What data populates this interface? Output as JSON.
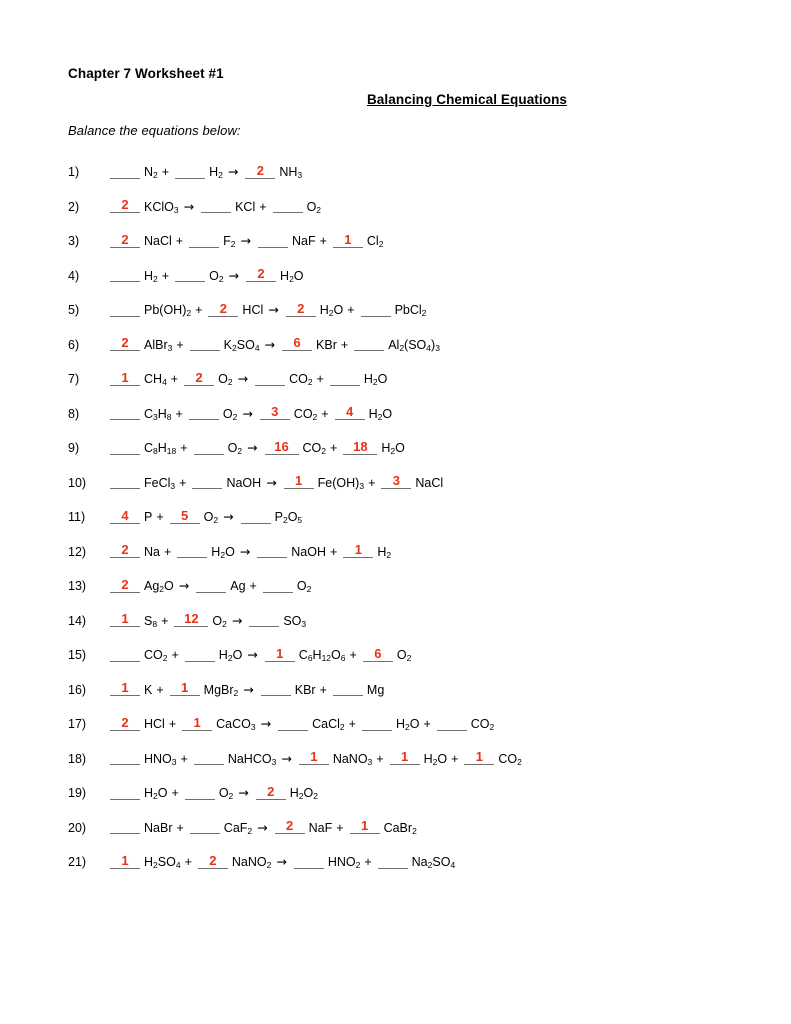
{
  "document": {
    "title": "Chapter 7 Worksheet #1",
    "worksheet_title": "Balancing Chemical Equations",
    "instruction": "Balance the equations below:",
    "answer_color": "#e8331a",
    "arrow": "→",
    "plus": "+"
  },
  "equations": [
    {
      "number": "1)",
      "parts": [
        {
          "type": "slot",
          "answer": ""
        },
        {
          "type": "term",
          "formula": "N",
          "sub": "2"
        },
        {
          "type": "op",
          "text": "+"
        },
        {
          "type": "slot",
          "answer": ""
        },
        {
          "type": "term",
          "formula": "H",
          "sub": "2"
        },
        {
          "type": "arrow"
        },
        {
          "type": "slot",
          "answer": "2"
        },
        {
          "type": "term",
          "formula": "NH",
          "sub": "3"
        }
      ]
    },
    {
      "number": "2)",
      "parts": [
        {
          "type": "slot",
          "answer": "2"
        },
        {
          "type": "term",
          "formula": "KClO",
          "sub": "3"
        },
        {
          "type": "arrow"
        },
        {
          "type": "slot",
          "answer": ""
        },
        {
          "type": "term",
          "formula": "KCl",
          "sub": ""
        },
        {
          "type": "op",
          "text": "+"
        },
        {
          "type": "slot",
          "answer": ""
        },
        {
          "type": "term",
          "formula": "O",
          "sub": "2"
        }
      ]
    },
    {
      "number": "3)",
      "parts": [
        {
          "type": "slot",
          "answer": "2"
        },
        {
          "type": "term",
          "formula": "NaCl",
          "sub": ""
        },
        {
          "type": "op",
          "text": "+"
        },
        {
          "type": "slot",
          "answer": ""
        },
        {
          "type": "term",
          "formula": "F",
          "sub": "2"
        },
        {
          "type": "arrow"
        },
        {
          "type": "slot",
          "answer": ""
        },
        {
          "type": "term",
          "formula": "NaF",
          "sub": ""
        },
        {
          "type": "op",
          "text": "+"
        },
        {
          "type": "slot",
          "answer": "1"
        },
        {
          "type": "term",
          "formula": "Cl",
          "sub": "2"
        }
      ]
    },
    {
      "number": "4)",
      "parts": [
        {
          "type": "slot",
          "answer": ""
        },
        {
          "type": "term",
          "formula": "H",
          "sub": "2"
        },
        {
          "type": "op",
          "text": "+"
        },
        {
          "type": "slot",
          "answer": ""
        },
        {
          "type": "term",
          "formula": "O",
          "sub": "2"
        },
        {
          "type": "arrow"
        },
        {
          "type": "slot",
          "answer": "2"
        },
        {
          "type": "term",
          "formula": "H",
          "sub": "2",
          "tail": "O"
        }
      ]
    },
    {
      "number": "5)",
      "parts": [
        {
          "type": "slot",
          "answer": ""
        },
        {
          "type": "term",
          "formula": "Pb(OH)",
          "sub": "2"
        },
        {
          "type": "op",
          "text": "+"
        },
        {
          "type": "slot",
          "answer": "2"
        },
        {
          "type": "term",
          "formula": "HCl",
          "sub": ""
        },
        {
          "type": "arrow"
        },
        {
          "type": "slot",
          "answer": "2"
        },
        {
          "type": "term",
          "formula": "H",
          "sub": "2",
          "tail": "O"
        },
        {
          "type": "op",
          "text": "+"
        },
        {
          "type": "slot",
          "answer": ""
        },
        {
          "type": "term",
          "formula": "PbCl",
          "sub": "2"
        }
      ]
    },
    {
      "number": "6)",
      "parts": [
        {
          "type": "slot",
          "answer": "2"
        },
        {
          "type": "term",
          "formula": "AlBr",
          "sub": "3"
        },
        {
          "type": "op",
          "text": "+"
        },
        {
          "type": "slot",
          "answer": ""
        },
        {
          "type": "term",
          "formula": "K",
          "sub": "2",
          "tail": "SO",
          "tail_sub": "4"
        },
        {
          "type": "arrow"
        },
        {
          "type": "slot",
          "answer": "6"
        },
        {
          "type": "term",
          "formula": "KBr",
          "sub": ""
        },
        {
          "type": "op",
          "text": "+"
        },
        {
          "type": "slot",
          "answer": ""
        },
        {
          "type": "term",
          "formula": "Al",
          "sub": "2",
          "tail": "(SO",
          "tail_sub": "4",
          "tail2": ")",
          "tail2_sub": "3"
        }
      ]
    },
    {
      "number": "7)",
      "parts": [
        {
          "type": "slot",
          "answer": "1"
        },
        {
          "type": "term",
          "formula": "CH",
          "sub": "4"
        },
        {
          "type": "op",
          "text": "+"
        },
        {
          "type": "slot",
          "answer": "2"
        },
        {
          "type": "term",
          "formula": "O",
          "sub": "2"
        },
        {
          "type": "arrow"
        },
        {
          "type": "slot",
          "answer": ""
        },
        {
          "type": "term",
          "formula": "CO",
          "sub": "2"
        },
        {
          "type": "op",
          "text": "+"
        },
        {
          "type": "slot",
          "answer": ""
        },
        {
          "type": "term",
          "formula": "H",
          "sub": "2",
          "tail": "O"
        }
      ]
    },
    {
      "number": "8)",
      "parts": [
        {
          "type": "slot",
          "answer": ""
        },
        {
          "type": "term",
          "formula": "C",
          "sub": "3",
          "tail": "H",
          "tail_sub": "8"
        },
        {
          "type": "op",
          "text": "+"
        },
        {
          "type": "slot",
          "answer": ""
        },
        {
          "type": "term",
          "formula": "O",
          "sub": "2"
        },
        {
          "type": "arrow"
        },
        {
          "type": "slot",
          "answer": "3"
        },
        {
          "type": "term",
          "formula": "CO",
          "sub": "2"
        },
        {
          "type": "op",
          "text": "+"
        },
        {
          "type": "slot",
          "answer": "4"
        },
        {
          "type": "term",
          "formula": "H",
          "sub": "2",
          "tail": "O"
        }
      ]
    },
    {
      "number": "9)",
      "parts": [
        {
          "type": "slot",
          "answer": ""
        },
        {
          "type": "term",
          "formula": "C",
          "sub": "8",
          "tail": "H",
          "tail_sub": "18"
        },
        {
          "type": "op",
          "text": "+"
        },
        {
          "type": "slot",
          "answer": ""
        },
        {
          "type": "term",
          "formula": "O",
          "sub": "2"
        },
        {
          "type": "arrow"
        },
        {
          "type": "slot",
          "answer": "16",
          "wide": true
        },
        {
          "type": "term",
          "formula": "CO",
          "sub": "2"
        },
        {
          "type": "op",
          "text": "+"
        },
        {
          "type": "slot",
          "answer": "18",
          "wide": true
        },
        {
          "type": "term",
          "formula": "H",
          "sub": "2",
          "tail": "O"
        }
      ]
    },
    {
      "number": "10)",
      "parts": [
        {
          "type": "slot",
          "answer": ""
        },
        {
          "type": "term",
          "formula": "FeCl",
          "sub": "3"
        },
        {
          "type": "op",
          "text": "+"
        },
        {
          "type": "slot",
          "answer": ""
        },
        {
          "type": "term",
          "formula": "NaOH",
          "sub": ""
        },
        {
          "type": "arrow"
        },
        {
          "type": "slot",
          "answer": "1"
        },
        {
          "type": "term",
          "formula": "Fe(OH)",
          "sub": "3"
        },
        {
          "type": "op",
          "text": "+"
        },
        {
          "type": "slot",
          "answer": "3"
        },
        {
          "type": "term",
          "formula": "NaCl",
          "sub": ""
        }
      ]
    },
    {
      "number": "11)",
      "parts": [
        {
          "type": "slot",
          "answer": "4"
        },
        {
          "type": "term",
          "formula": "P",
          "sub": ""
        },
        {
          "type": "op",
          "text": "+"
        },
        {
          "type": "slot",
          "answer": "5"
        },
        {
          "type": "term",
          "formula": "O",
          "sub": "2"
        },
        {
          "type": "arrow"
        },
        {
          "type": "slot",
          "answer": ""
        },
        {
          "type": "term",
          "formula": "P",
          "sub": "2",
          "tail": "O",
          "tail_sub": "5"
        }
      ]
    },
    {
      "number": "12)",
      "parts": [
        {
          "type": "slot",
          "answer": "2"
        },
        {
          "type": "term",
          "formula": "Na",
          "sub": ""
        },
        {
          "type": "op",
          "text": "+"
        },
        {
          "type": "slot",
          "answer": ""
        },
        {
          "type": "term",
          "formula": "H",
          "sub": "2",
          "tail": "O"
        },
        {
          "type": "arrow"
        },
        {
          "type": "slot",
          "answer": ""
        },
        {
          "type": "term",
          "formula": "NaOH",
          "sub": ""
        },
        {
          "type": "op",
          "text": "+"
        },
        {
          "type": "slot",
          "answer": "1"
        },
        {
          "type": "term",
          "formula": "H",
          "sub": "2"
        }
      ]
    },
    {
      "number": "13)",
      "parts": [
        {
          "type": "slot",
          "answer": "2"
        },
        {
          "type": "term",
          "formula": "Ag",
          "sub": "2",
          "tail": "O"
        },
        {
          "type": "arrow"
        },
        {
          "type": "slot",
          "answer": ""
        },
        {
          "type": "term",
          "formula": "Ag",
          "sub": ""
        },
        {
          "type": "op",
          "text": "+"
        },
        {
          "type": "slot",
          "answer": ""
        },
        {
          "type": "term",
          "formula": "O",
          "sub": "2"
        }
      ]
    },
    {
      "number": "14)",
      "parts": [
        {
          "type": "slot",
          "answer": "1"
        },
        {
          "type": "term",
          "formula": "S",
          "sub": "8"
        },
        {
          "type": "op",
          "text": "+"
        },
        {
          "type": "slot",
          "answer": "12",
          "wide": true
        },
        {
          "type": "term",
          "formula": "O",
          "sub": "2"
        },
        {
          "type": "arrow"
        },
        {
          "type": "slot",
          "answer": ""
        },
        {
          "type": "term",
          "formula": "SO",
          "sub": "3"
        }
      ]
    },
    {
      "number": "15)",
      "parts": [
        {
          "type": "slot",
          "answer": ""
        },
        {
          "type": "term",
          "formula": "CO",
          "sub": "2"
        },
        {
          "type": "op",
          "text": "+"
        },
        {
          "type": "slot",
          "answer": ""
        },
        {
          "type": "term",
          "formula": "H",
          "sub": "2",
          "tail": "O"
        },
        {
          "type": "arrow"
        },
        {
          "type": "slot",
          "answer": "1"
        },
        {
          "type": "term",
          "formula": "C",
          "sub": "6",
          "tail": "H",
          "tail_sub": "12",
          "tail2": "O",
          "tail2_sub": "6"
        },
        {
          "type": "op",
          "text": "+"
        },
        {
          "type": "slot",
          "answer": "6"
        },
        {
          "type": "term",
          "formula": "O",
          "sub": "2"
        }
      ]
    },
    {
      "number": "16)",
      "parts": [
        {
          "type": "slot",
          "answer": "1"
        },
        {
          "type": "term",
          "formula": "K",
          "sub": ""
        },
        {
          "type": "op",
          "text": "+"
        },
        {
          "type": "slot",
          "answer": "1"
        },
        {
          "type": "term",
          "formula": "MgBr",
          "sub": "2"
        },
        {
          "type": "arrow"
        },
        {
          "type": "slot",
          "answer": ""
        },
        {
          "type": "term",
          "formula": "KBr",
          "sub": ""
        },
        {
          "type": "op",
          "text": "+"
        },
        {
          "type": "slot",
          "answer": ""
        },
        {
          "type": "term",
          "formula": "Mg",
          "sub": ""
        }
      ]
    },
    {
      "number": "17)",
      "parts": [
        {
          "type": "slot",
          "answer": "2"
        },
        {
          "type": "term",
          "formula": "HCl",
          "sub": ""
        },
        {
          "type": "op",
          "text": "+"
        },
        {
          "type": "slot",
          "answer": "1"
        },
        {
          "type": "term",
          "formula": "CaCO",
          "sub": "3"
        },
        {
          "type": "arrow"
        },
        {
          "type": "slot",
          "answer": ""
        },
        {
          "type": "term",
          "formula": "CaCl",
          "sub": "2"
        },
        {
          "type": "op",
          "text": "+"
        },
        {
          "type": "slot",
          "answer": ""
        },
        {
          "type": "term",
          "formula": "H",
          "sub": "2",
          "tail": "O"
        },
        {
          "type": "op",
          "text": "+"
        },
        {
          "type": "slot",
          "answer": ""
        },
        {
          "type": "term",
          "formula": "CO",
          "sub": "2"
        }
      ]
    },
    {
      "number": "18)",
      "parts": [
        {
          "type": "slot",
          "answer": ""
        },
        {
          "type": "term",
          "formula": "HNO",
          "sub": "3"
        },
        {
          "type": "op",
          "text": "+"
        },
        {
          "type": "slot",
          "answer": ""
        },
        {
          "type": "term",
          "formula": "NaHCO",
          "sub": "3"
        },
        {
          "type": "arrow"
        },
        {
          "type": "slot",
          "answer": "1"
        },
        {
          "type": "term",
          "formula": "NaNO",
          "sub": "3"
        },
        {
          "type": "op",
          "text": "+"
        },
        {
          "type": "slot",
          "answer": "1"
        },
        {
          "type": "term",
          "formula": "H",
          "sub": "2",
          "tail": "O"
        },
        {
          "type": "op",
          "text": "+"
        },
        {
          "type": "slot",
          "answer": "1"
        },
        {
          "type": "term",
          "formula": "CO",
          "sub": "2"
        }
      ]
    },
    {
      "number": "19)",
      "parts": [
        {
          "type": "slot",
          "answer": ""
        },
        {
          "type": "term",
          "formula": "H",
          "sub": "2",
          "tail": "O"
        },
        {
          "type": "op",
          "text": "+"
        },
        {
          "type": "slot",
          "answer": ""
        },
        {
          "type": "term",
          "formula": "O",
          "sub": "2"
        },
        {
          "type": "arrow"
        },
        {
          "type": "slot",
          "answer": "2"
        },
        {
          "type": "term",
          "formula": "H",
          "sub": "2",
          "tail": "O",
          "tail_sub": "2"
        }
      ]
    },
    {
      "number": "20)",
      "parts": [
        {
          "type": "slot",
          "answer": ""
        },
        {
          "type": "term",
          "formula": "NaBr",
          "sub": ""
        },
        {
          "type": "op",
          "text": "+"
        },
        {
          "type": "slot",
          "answer": ""
        },
        {
          "type": "term",
          "formula": "CaF",
          "sub": "2"
        },
        {
          "type": "arrow"
        },
        {
          "type": "slot",
          "answer": "2"
        },
        {
          "type": "term",
          "formula": "NaF",
          "sub": ""
        },
        {
          "type": "op",
          "text": "+"
        },
        {
          "type": "slot",
          "answer": "1"
        },
        {
          "type": "term",
          "formula": "CaBr",
          "sub": "2"
        }
      ]
    },
    {
      "number": "21)",
      "parts": [
        {
          "type": "slot",
          "answer": "1"
        },
        {
          "type": "term",
          "formula": "H",
          "sub": "2",
          "tail": "SO",
          "tail_sub": "4"
        },
        {
          "type": "op",
          "text": "+"
        },
        {
          "type": "slot",
          "answer": "2"
        },
        {
          "type": "term",
          "formula": "NaNO",
          "sub": "2"
        },
        {
          "type": "arrow"
        },
        {
          "type": "slot",
          "answer": ""
        },
        {
          "type": "term",
          "formula": "HNO",
          "sub": "2"
        },
        {
          "type": "op",
          "text": "+"
        },
        {
          "type": "slot",
          "answer": ""
        },
        {
          "type": "term",
          "formula": "Na",
          "sub": "2",
          "tail": "SO",
          "tail_sub": "4"
        }
      ]
    }
  ]
}
